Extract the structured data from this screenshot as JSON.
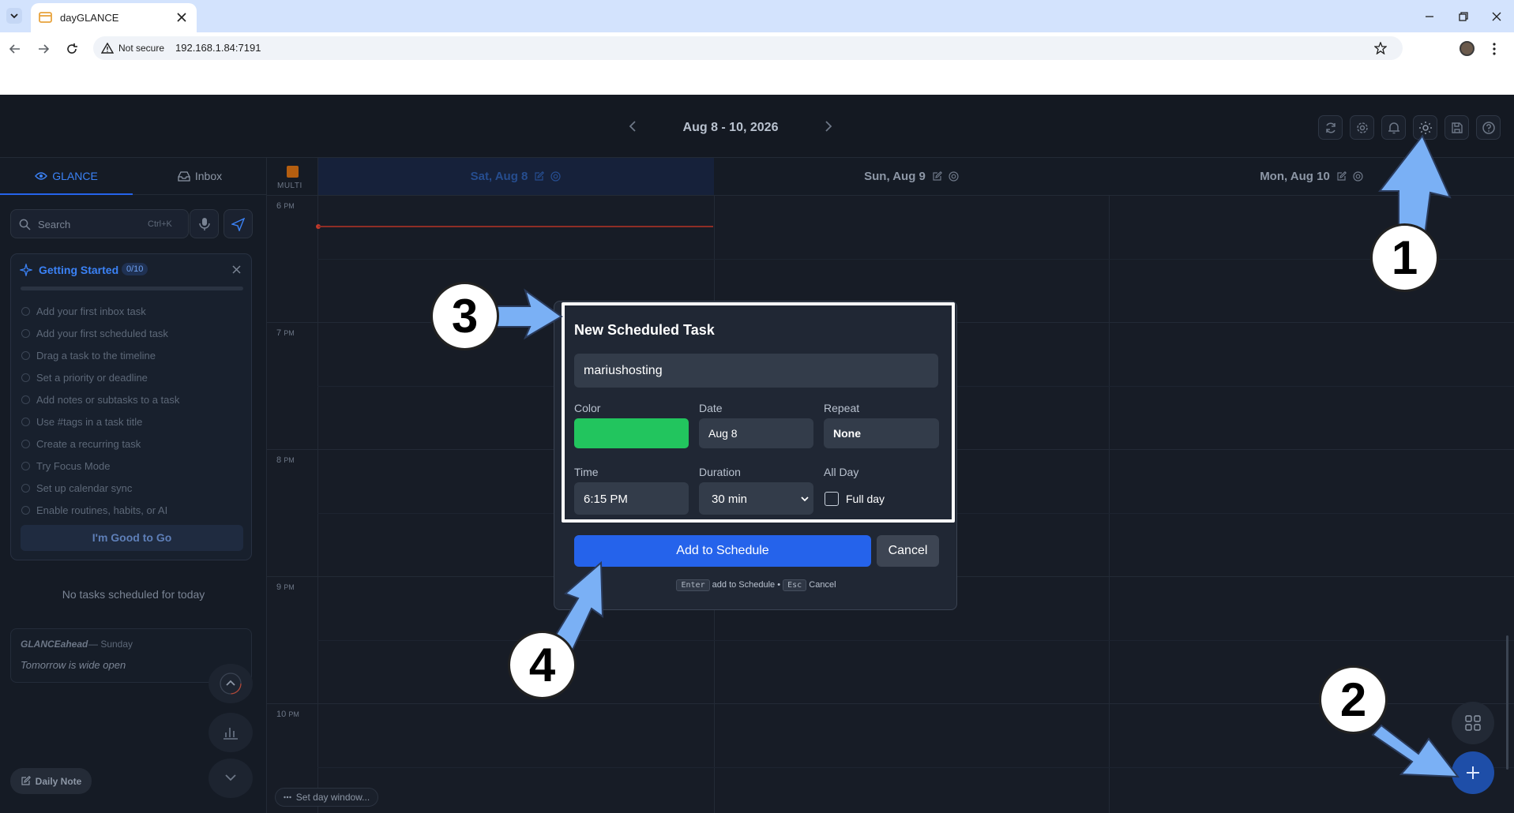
{
  "browser": {
    "tab_title": "dayGLANCE",
    "security_label": "Not secure",
    "url": "192.168.1.84:7191"
  },
  "header": {
    "date_range": "Aug 8 - 10, 2026"
  },
  "sidebar": {
    "tabs": [
      {
        "label": "GLANCE"
      },
      {
        "label": "Inbox"
      }
    ],
    "search_placeholder": "Search",
    "search_shortcut": "Ctrl+K",
    "getting_started": {
      "title": "Getting Started",
      "progress": "0/10",
      "items": [
        "Add your first inbox task",
        "Add your first scheduled task",
        "Drag a task to the timeline",
        "Set a priority or deadline",
        "Add notes or subtasks to a task",
        "Use #tags in a task title",
        "Create a recurring task",
        "Try Focus Mode",
        "Set up calendar sync",
        "Enable routines, habits, or AI"
      ],
      "done_button": "I'm Good to Go"
    },
    "empty_today": "No tasks scheduled for today",
    "ahead_title": "GLANCEahead",
    "ahead_day": "— Sunday",
    "ahead_text": "Tomorrow is wide open",
    "daily_note": "Daily Note"
  },
  "calendar": {
    "multi_label": "MULTI",
    "days": [
      {
        "label": "Sat, Aug 8"
      },
      {
        "label": "Sun, Aug 9"
      },
      {
        "label": "Mon, Aug 10"
      }
    ],
    "hours": [
      {
        "num": "6",
        "suffix": "PM"
      },
      {
        "num": "7",
        "suffix": "PM"
      },
      {
        "num": "8",
        "suffix": "PM"
      },
      {
        "num": "9",
        "suffix": "PM"
      },
      {
        "num": "10",
        "suffix": "PM"
      }
    ],
    "set_day_window": "Set day window..."
  },
  "modal": {
    "title": "New Scheduled Task",
    "task_name": "mariushosting",
    "color_label": "Color",
    "color_value": "#22c55e",
    "date_label": "Date",
    "date_value": "Aug 8",
    "repeat_label": "Repeat",
    "repeat_value": "None",
    "time_label": "Time",
    "time_value": "6:15 PM",
    "duration_label": "Duration",
    "duration_value": "30 min",
    "allday_label": "All Day",
    "fullday_label": "Full day",
    "add_button": "Add to Schedule",
    "cancel_button": "Cancel",
    "hint_key_enter": "Enter",
    "hint_enter_text": "add to Schedule •",
    "hint_key_esc": "Esc",
    "hint_esc_text": "Cancel"
  },
  "annotations": [
    "1",
    "2",
    "3",
    "4"
  ],
  "colors": {
    "accent": "#2563eb",
    "arrow": "#7ab0f5",
    "now_line": "#c0392b"
  }
}
